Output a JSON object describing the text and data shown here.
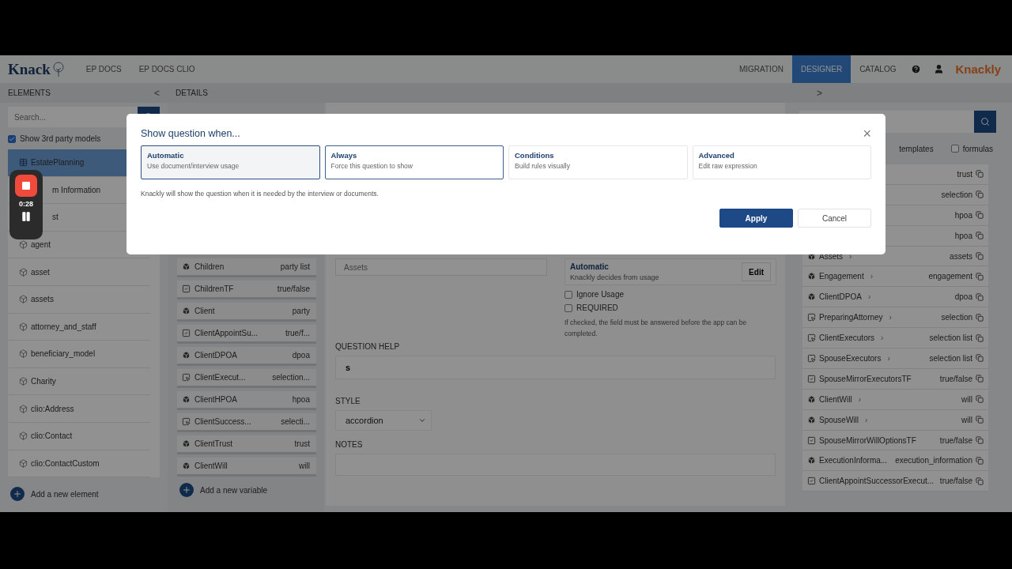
{
  "navbar": {
    "logo": "Knack",
    "left_links": [
      {
        "label": "EP DOCS",
        "selected": false
      },
      {
        "label": "EP DOCS CLIO",
        "selected": false
      }
    ],
    "right_links": [
      {
        "label": "MIGRATION",
        "selected": false
      },
      {
        "label": "DESIGNER",
        "selected": true
      },
      {
        "label": "CATALOG",
        "selected": false
      }
    ],
    "brand": "Knackly"
  },
  "elements": {
    "title": "ELEMENTS",
    "collapse": "<",
    "search": {
      "placeholder": "Search..."
    },
    "third_party": {
      "label": "Show 3rd party models",
      "checked": true
    },
    "items": [
      {
        "label": "EstatePlanning",
        "kind": "table",
        "selected": true
      },
      {
        "label": "m Information",
        "kind": "hidden",
        "selected": false
      },
      {
        "label": "st",
        "kind": "hidden",
        "selected": false
      },
      {
        "label": "agent",
        "kind": "model",
        "selected": false
      },
      {
        "label": "asset",
        "kind": "model",
        "selected": false
      },
      {
        "label": "assets",
        "kind": "model",
        "selected": false
      },
      {
        "label": "attorney_and_staff",
        "kind": "model",
        "selected": false
      },
      {
        "label": "beneficiary_model",
        "kind": "model",
        "selected": false
      },
      {
        "label": "Charity",
        "kind": "model",
        "selected": false
      },
      {
        "label": "clio:Address",
        "kind": "model",
        "selected": false
      },
      {
        "label": "clio:Contact",
        "kind": "model",
        "selected": false
      },
      {
        "label": "clio:ContactCustom",
        "kind": "model",
        "selected": false
      }
    ],
    "add": "Add a new element"
  },
  "variables": {
    "items": [
      {
        "name": "Children",
        "type": "party list",
        "kind": "object"
      },
      {
        "name": "ChildrenTF",
        "type": "true/false",
        "kind": "boolean"
      },
      {
        "name": "Client",
        "type": "party",
        "kind": "object"
      },
      {
        "name": "ClientAppointSu...",
        "type": "true/f...",
        "kind": "boolean"
      },
      {
        "name": "ClientDPOA",
        "type": "dpoa",
        "kind": "object"
      },
      {
        "name": "ClientExecut...",
        "type": "selection...",
        "kind": "selection"
      },
      {
        "name": "ClientHPOA",
        "type": "hpoa",
        "kind": "object"
      },
      {
        "name": "ClientSuccess...",
        "type": "selecti...",
        "kind": "selection"
      },
      {
        "name": "ClientTrust",
        "type": "trust",
        "kind": "object"
      },
      {
        "name": "ClientWill",
        "type": "will",
        "kind": "object"
      }
    ],
    "add": "Add a new variable"
  },
  "details": {
    "title": "DETAILS",
    "expand": ">",
    "name_field": {
      "placeholder": "Assets"
    },
    "show_when": {
      "title": "Automatic",
      "subtitle": "Knackly decides from usage",
      "edit": "Edit"
    },
    "checkboxes": [
      {
        "label": "Ignore Usage",
        "checked": false
      },
      {
        "label": "REQUIRED",
        "checked": false
      }
    ],
    "required_help": "If checked, the field must be answered before the app can be completed.",
    "question_help": {
      "label": "QUESTION HELP",
      "value": "s"
    },
    "style": {
      "label": "STYLE",
      "value": "accordion"
    },
    "notes": {
      "label": "NOTES"
    }
  },
  "types_panel": {
    "filters": [
      {
        "label": "templates"
      },
      {
        "label": "formulas",
        "checked": false
      }
    ],
    "rows": [
      {
        "type": "trust"
      },
      {
        "type": "selection"
      },
      {
        "type": "hpoa"
      },
      {
        "type": "hpoa"
      },
      {
        "name": "Assets",
        "type": "assets",
        "kind": "object",
        "chevron": "›"
      },
      {
        "name": "Engagement",
        "type": "engagement",
        "kind": "object",
        "chevron": "›"
      },
      {
        "name": "ClientDPOA",
        "type": "dpoa",
        "kind": "object",
        "chevron": "›"
      },
      {
        "name": "PreparingAttorney",
        "type": "selection",
        "kind": "selection",
        "chevron": "›"
      },
      {
        "name": "ClientExecutors",
        "type": "selection list",
        "kind": "selection",
        "chevron": "›"
      },
      {
        "name": "SpouseExecutors",
        "type": "selection list",
        "kind": "selection",
        "chevron": "›"
      },
      {
        "name": "SpouseMirrorExecutorsTF",
        "type": "true/false",
        "kind": "boolean"
      },
      {
        "name": "ClientWill",
        "type": "will",
        "kind": "object",
        "chevron": "›"
      },
      {
        "name": "SpouseWill",
        "type": "will",
        "kind": "object",
        "chevron": "›"
      },
      {
        "name": "SpouseMirrorWillOptionsTF",
        "type": "true/false",
        "kind": "boolean"
      },
      {
        "name": "ExecutionInforma...",
        "type": "execution_information",
        "kind": "object"
      },
      {
        "name": "ClientAppointSuccessorExecut...",
        "type": "true/false",
        "kind": "boolean"
      }
    ]
  },
  "recorder": {
    "time": "0:28"
  },
  "dialog": {
    "title": "Show question when...",
    "close": "×",
    "options": [
      {
        "title": "Automatic",
        "subtitle": "Use document/interview usage",
        "selected": true,
        "hovered": false
      },
      {
        "title": "Always",
        "subtitle": "Force this question to show",
        "selected": false,
        "hovered": true
      },
      {
        "title": "Conditions",
        "subtitle": "Build rules visually",
        "selected": false,
        "hovered": false
      },
      {
        "title": "Advanced",
        "subtitle": "Edit raw expression",
        "selected": false,
        "hovered": false
      }
    ],
    "description": "Knackly will show the question when it is needed by the interview or documents.",
    "buttons": [
      {
        "label": "Apply",
        "kind": "primary"
      },
      {
        "label": "Cancel",
        "kind": "secondary"
      }
    ]
  }
}
